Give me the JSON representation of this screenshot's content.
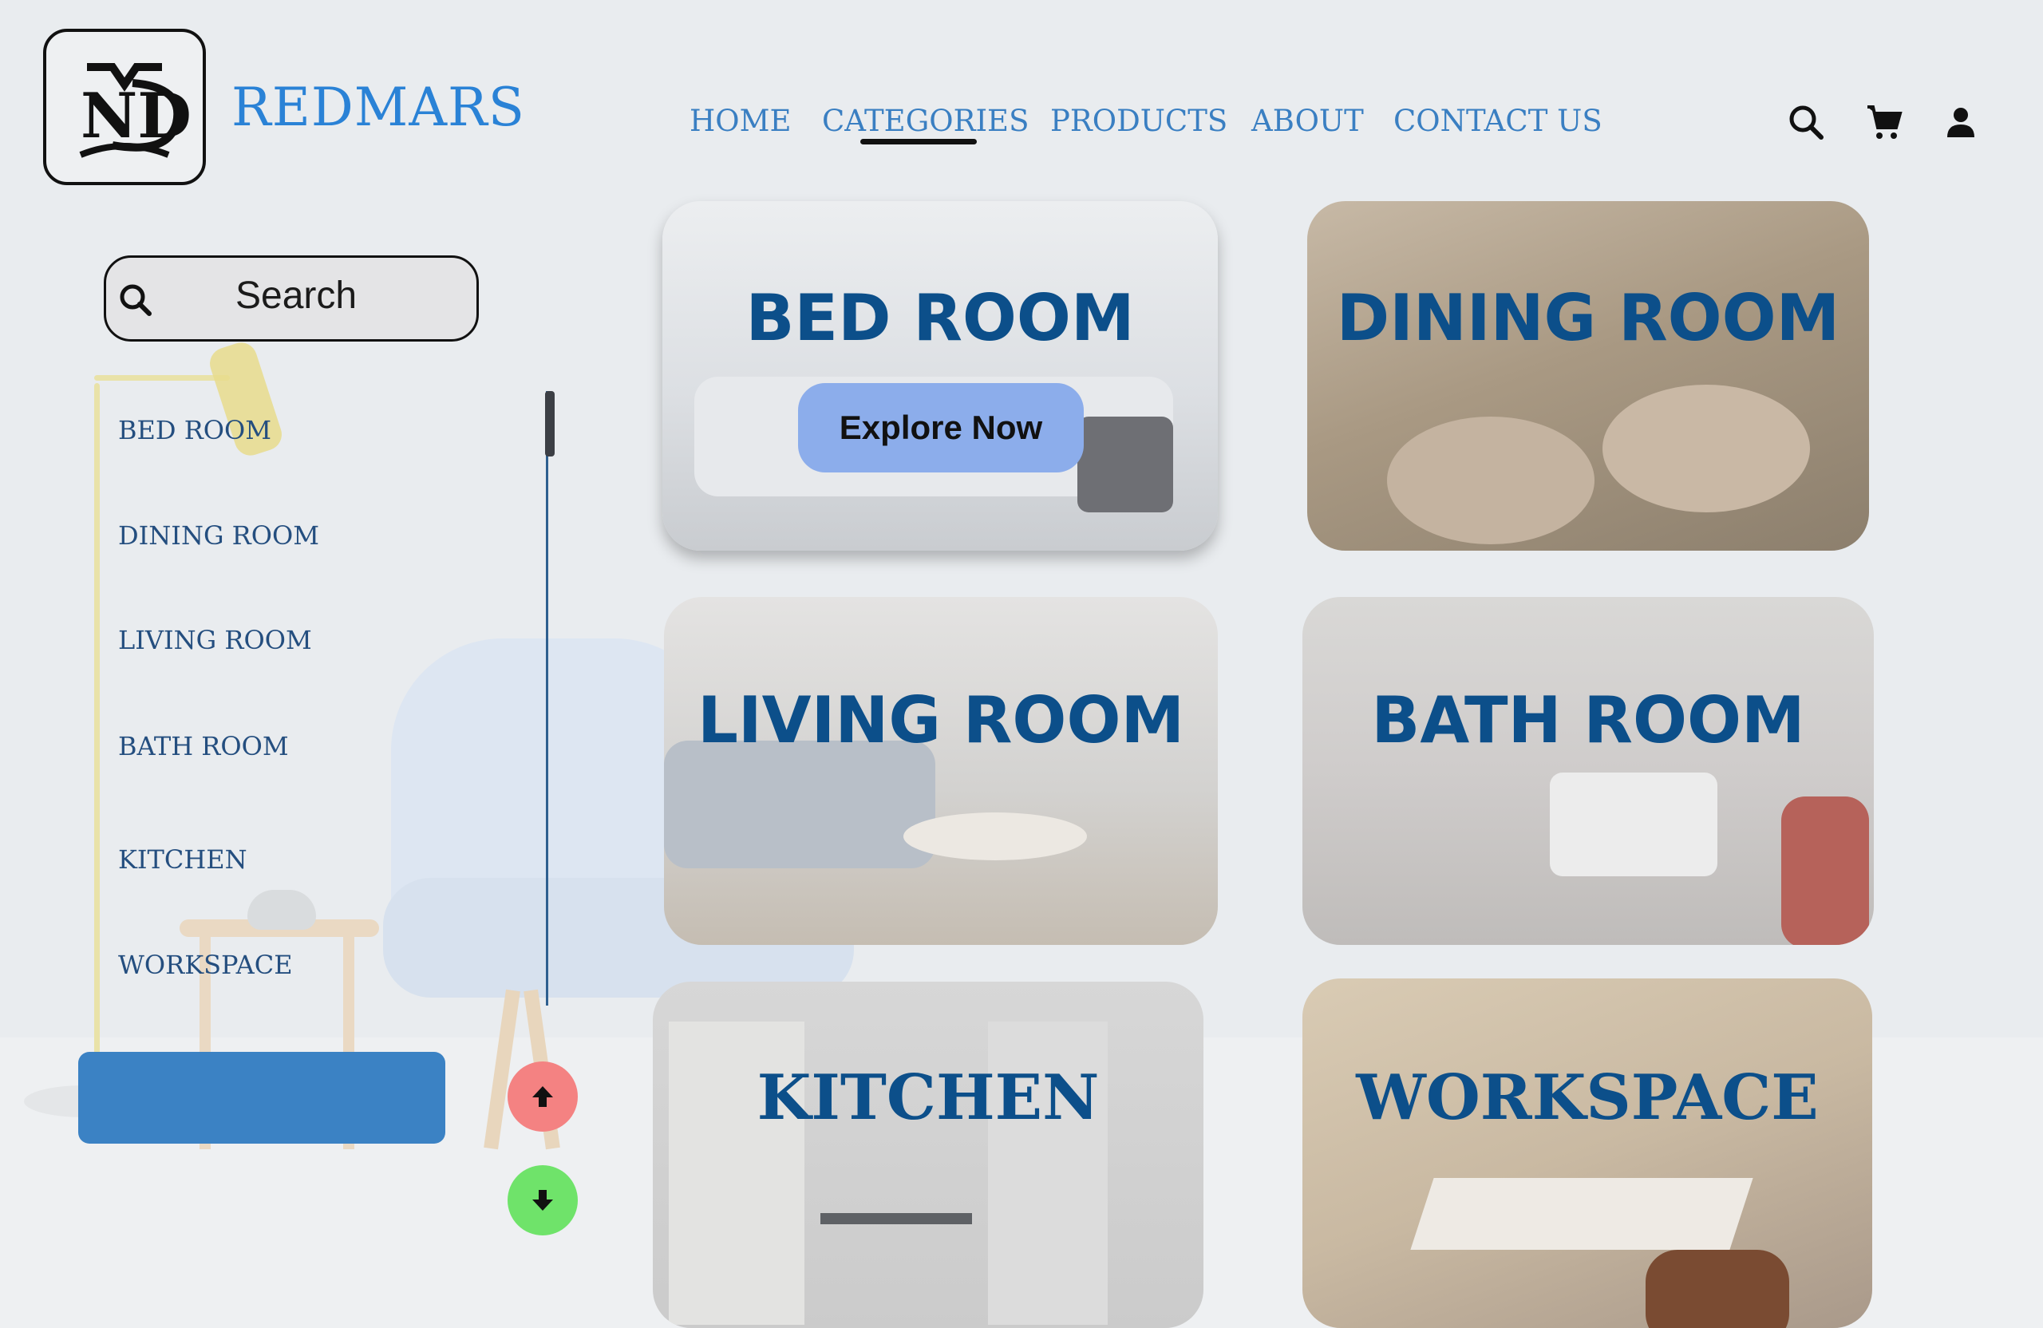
{
  "brand": {
    "name": "REDMARS",
    "logo_letters": "ND"
  },
  "nav": {
    "items": [
      "HOME",
      "CATEGORIES",
      "PRODUCTS",
      "ABOUT",
      "CONTACT US"
    ],
    "active": "CATEGORIES"
  },
  "header_icons": [
    "search-icon",
    "cart-icon",
    "user-icon"
  ],
  "search": {
    "label": "Search"
  },
  "sidebar": {
    "items": [
      "BED ROOM",
      "DINING ROOM",
      "LIVING ROOM",
      "BATH ROOM",
      "KITCHEN",
      "WORKSPACE"
    ]
  },
  "controls": {
    "up_icon": "arrow-up-icon",
    "down_icon": "arrow-down-icon"
  },
  "cards": [
    {
      "title": "BED ROOM",
      "button": "Explore Now"
    },
    {
      "title": "DINING ROOM"
    },
    {
      "title": "LIVING ROOM"
    },
    {
      "title": "BATH ROOM"
    },
    {
      "title": "KITCHEN"
    },
    {
      "title": "WORKSPACE"
    }
  ],
  "colors": {
    "accent_blue": "#3b82c4",
    "brand_blue": "#2a82d6",
    "card_title": "#0c4f8a",
    "up_button": "#f48282",
    "down_button": "#6fe36a"
  }
}
